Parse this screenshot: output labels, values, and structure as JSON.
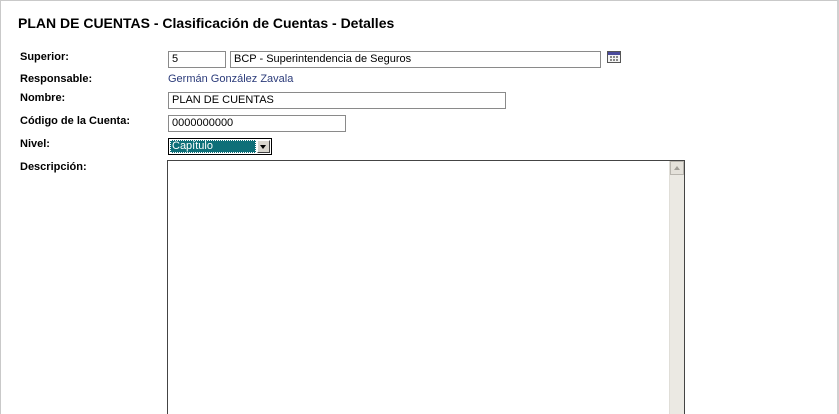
{
  "page": {
    "title": "PLAN DE CUENTAS - Clasificación de Cuentas - Detalles"
  },
  "form": {
    "superior": {
      "label": "Superior:",
      "code": "5",
      "name": "BCP - Superintendencia de Seguros",
      "picker_icon": "calendar-icon"
    },
    "responsable": {
      "label": "Responsable:",
      "value": "Germán González Zavala"
    },
    "nombre": {
      "label": "Nombre:",
      "value": "PLAN DE CUENTAS"
    },
    "codigo": {
      "label": "Código de la Cuenta:",
      "value": "0000000000"
    },
    "nivel": {
      "label": "Nivel:",
      "selected": "Capítulo"
    },
    "descripcion": {
      "label": "Descripción:",
      "value": ""
    }
  },
  "colors": {
    "link_text": "#2b3b7a",
    "select_highlight": "#0e6f78"
  }
}
